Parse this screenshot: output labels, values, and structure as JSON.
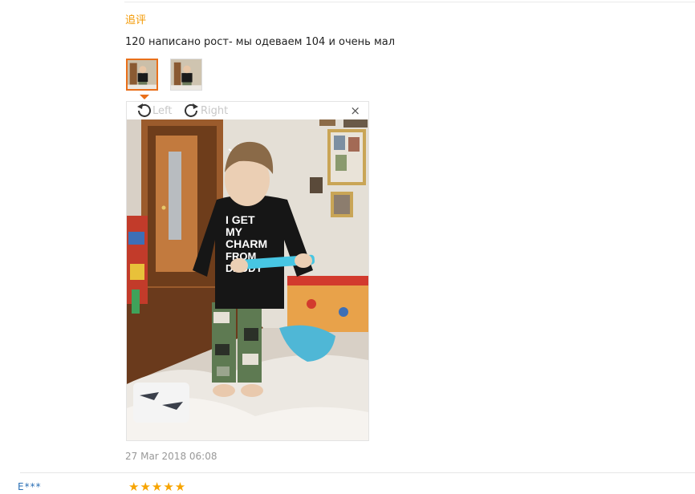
{
  "review": {
    "followup_label": "追评",
    "text": "120 написано рост- мы одеваем 104 и очень мал",
    "date": "27 Mar 2018 06:08"
  },
  "viewer": {
    "rotate_left_label": "Left",
    "rotate_right_label": "Right",
    "close_glyph": "×",
    "rotate_left_icon": "rotate-left-icon",
    "rotate_right_icon": "rotate-right-icon",
    "close_icon": "close-icon"
  },
  "photo_shirt_text": [
    "I GET",
    "MY",
    "CHARM",
    "FROM",
    "DADDY"
  ],
  "next_review": {
    "user_initials": "E***",
    "stars": "★★★★★"
  },
  "colors": {
    "accent_orange": "#e96f1a",
    "followup_orange": "#f39800",
    "star": "#f7a400"
  }
}
